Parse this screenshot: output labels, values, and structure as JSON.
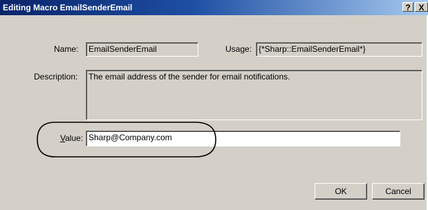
{
  "window": {
    "title": "Editing Macro EmailSenderEmail",
    "help_button": "?",
    "close_button": "X"
  },
  "form": {
    "name_label": "Name:",
    "name_value": "EmailSenderEmail",
    "usage_label": "Usage:",
    "usage_value": "{*Sharp::EmailSenderEmail*}",
    "description_label": "Description:",
    "description_value": "The email address of the sender for email notifications.",
    "value_label_accel": "V",
    "value_label_rest": "alue:",
    "value_value": "Sharp@Company.com"
  },
  "buttons": {
    "ok": "OK",
    "cancel": "Cancel"
  },
  "annotation": {
    "highlight_color": "#000000"
  }
}
